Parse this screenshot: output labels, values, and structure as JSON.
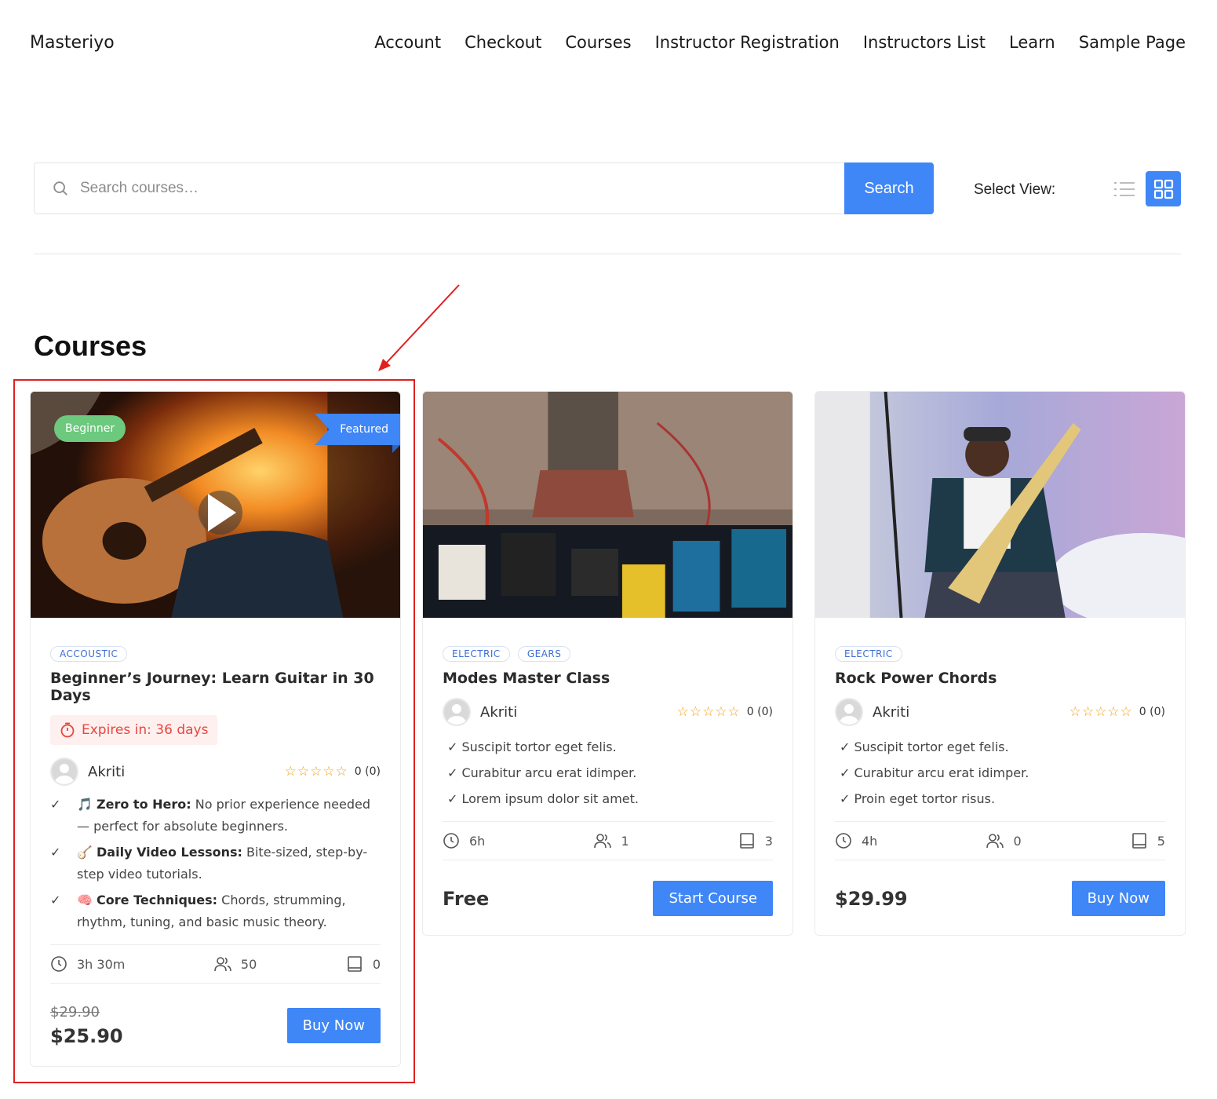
{
  "site": {
    "title": "Masteriyo"
  },
  "nav": [
    "Account",
    "Checkout",
    "Courses",
    "Instructor Registration",
    "Instructors List",
    "Learn",
    "Sample Page"
  ],
  "search": {
    "placeholder": "Search courses…",
    "button_label": "Search"
  },
  "view": {
    "label": "Select View:",
    "active": "grid"
  },
  "heading": "Courses",
  "colors": {
    "primary": "#3f86f7",
    "badge_green": "#6cc97d",
    "expires_red": "#e7473f",
    "star": "#f0a21b",
    "annotation": "#e02020"
  },
  "courses": [
    {
      "level": "Beginner",
      "featured": "Featured",
      "tags": [
        "ACCOUSTIC"
      ],
      "title": "Beginner’s Journey: Learn Guitar in 30 Days",
      "expires": "Expires in: 36 days",
      "author": "Akriti",
      "rating": "0 (0)",
      "features": [
        {
          "icon": "🎵",
          "title": "Zero to Hero:",
          "text": " No prior experience needed — perfect for absolute beginners."
        },
        {
          "icon": "🪕",
          "title": "Daily Video Lessons:",
          "text": " Bite-sized, step-by-step video tutorials."
        },
        {
          "icon": "🧠",
          "title": "Core Techniques:",
          "text": " Chords, strumming, rhythm, tuning, and basic music theory."
        }
      ],
      "duration": "3h 30m",
      "students": "50",
      "lessons": "0",
      "old_price": "$29.90",
      "price": "$25.90",
      "button": "Buy Now"
    },
    {
      "tags": [
        "ELECTRIC",
        "GEARS"
      ],
      "title": "Modes Master Class",
      "author": "Akriti",
      "rating": "0 (0)",
      "points": [
        "✓ Suscipit tortor eget felis.",
        "✓ Curabitur arcu erat idimper.",
        "✓ Lorem ipsum dolor sit amet."
      ],
      "duration": "6h",
      "students": "1",
      "lessons": "3",
      "price": "Free",
      "button": "Start Course"
    },
    {
      "tags": [
        "ELECTRIC"
      ],
      "title": "Rock Power Chords",
      "author": "Akriti",
      "rating": "0 (0)",
      "points": [
        "✓ Suscipit tortor eget felis.",
        "✓ Curabitur arcu erat idimper.",
        "✓ Proin eget tortor risus."
      ],
      "duration": "4h",
      "students": "0",
      "lessons": "5",
      "price": "$29.99",
      "button": "Buy Now"
    }
  ]
}
